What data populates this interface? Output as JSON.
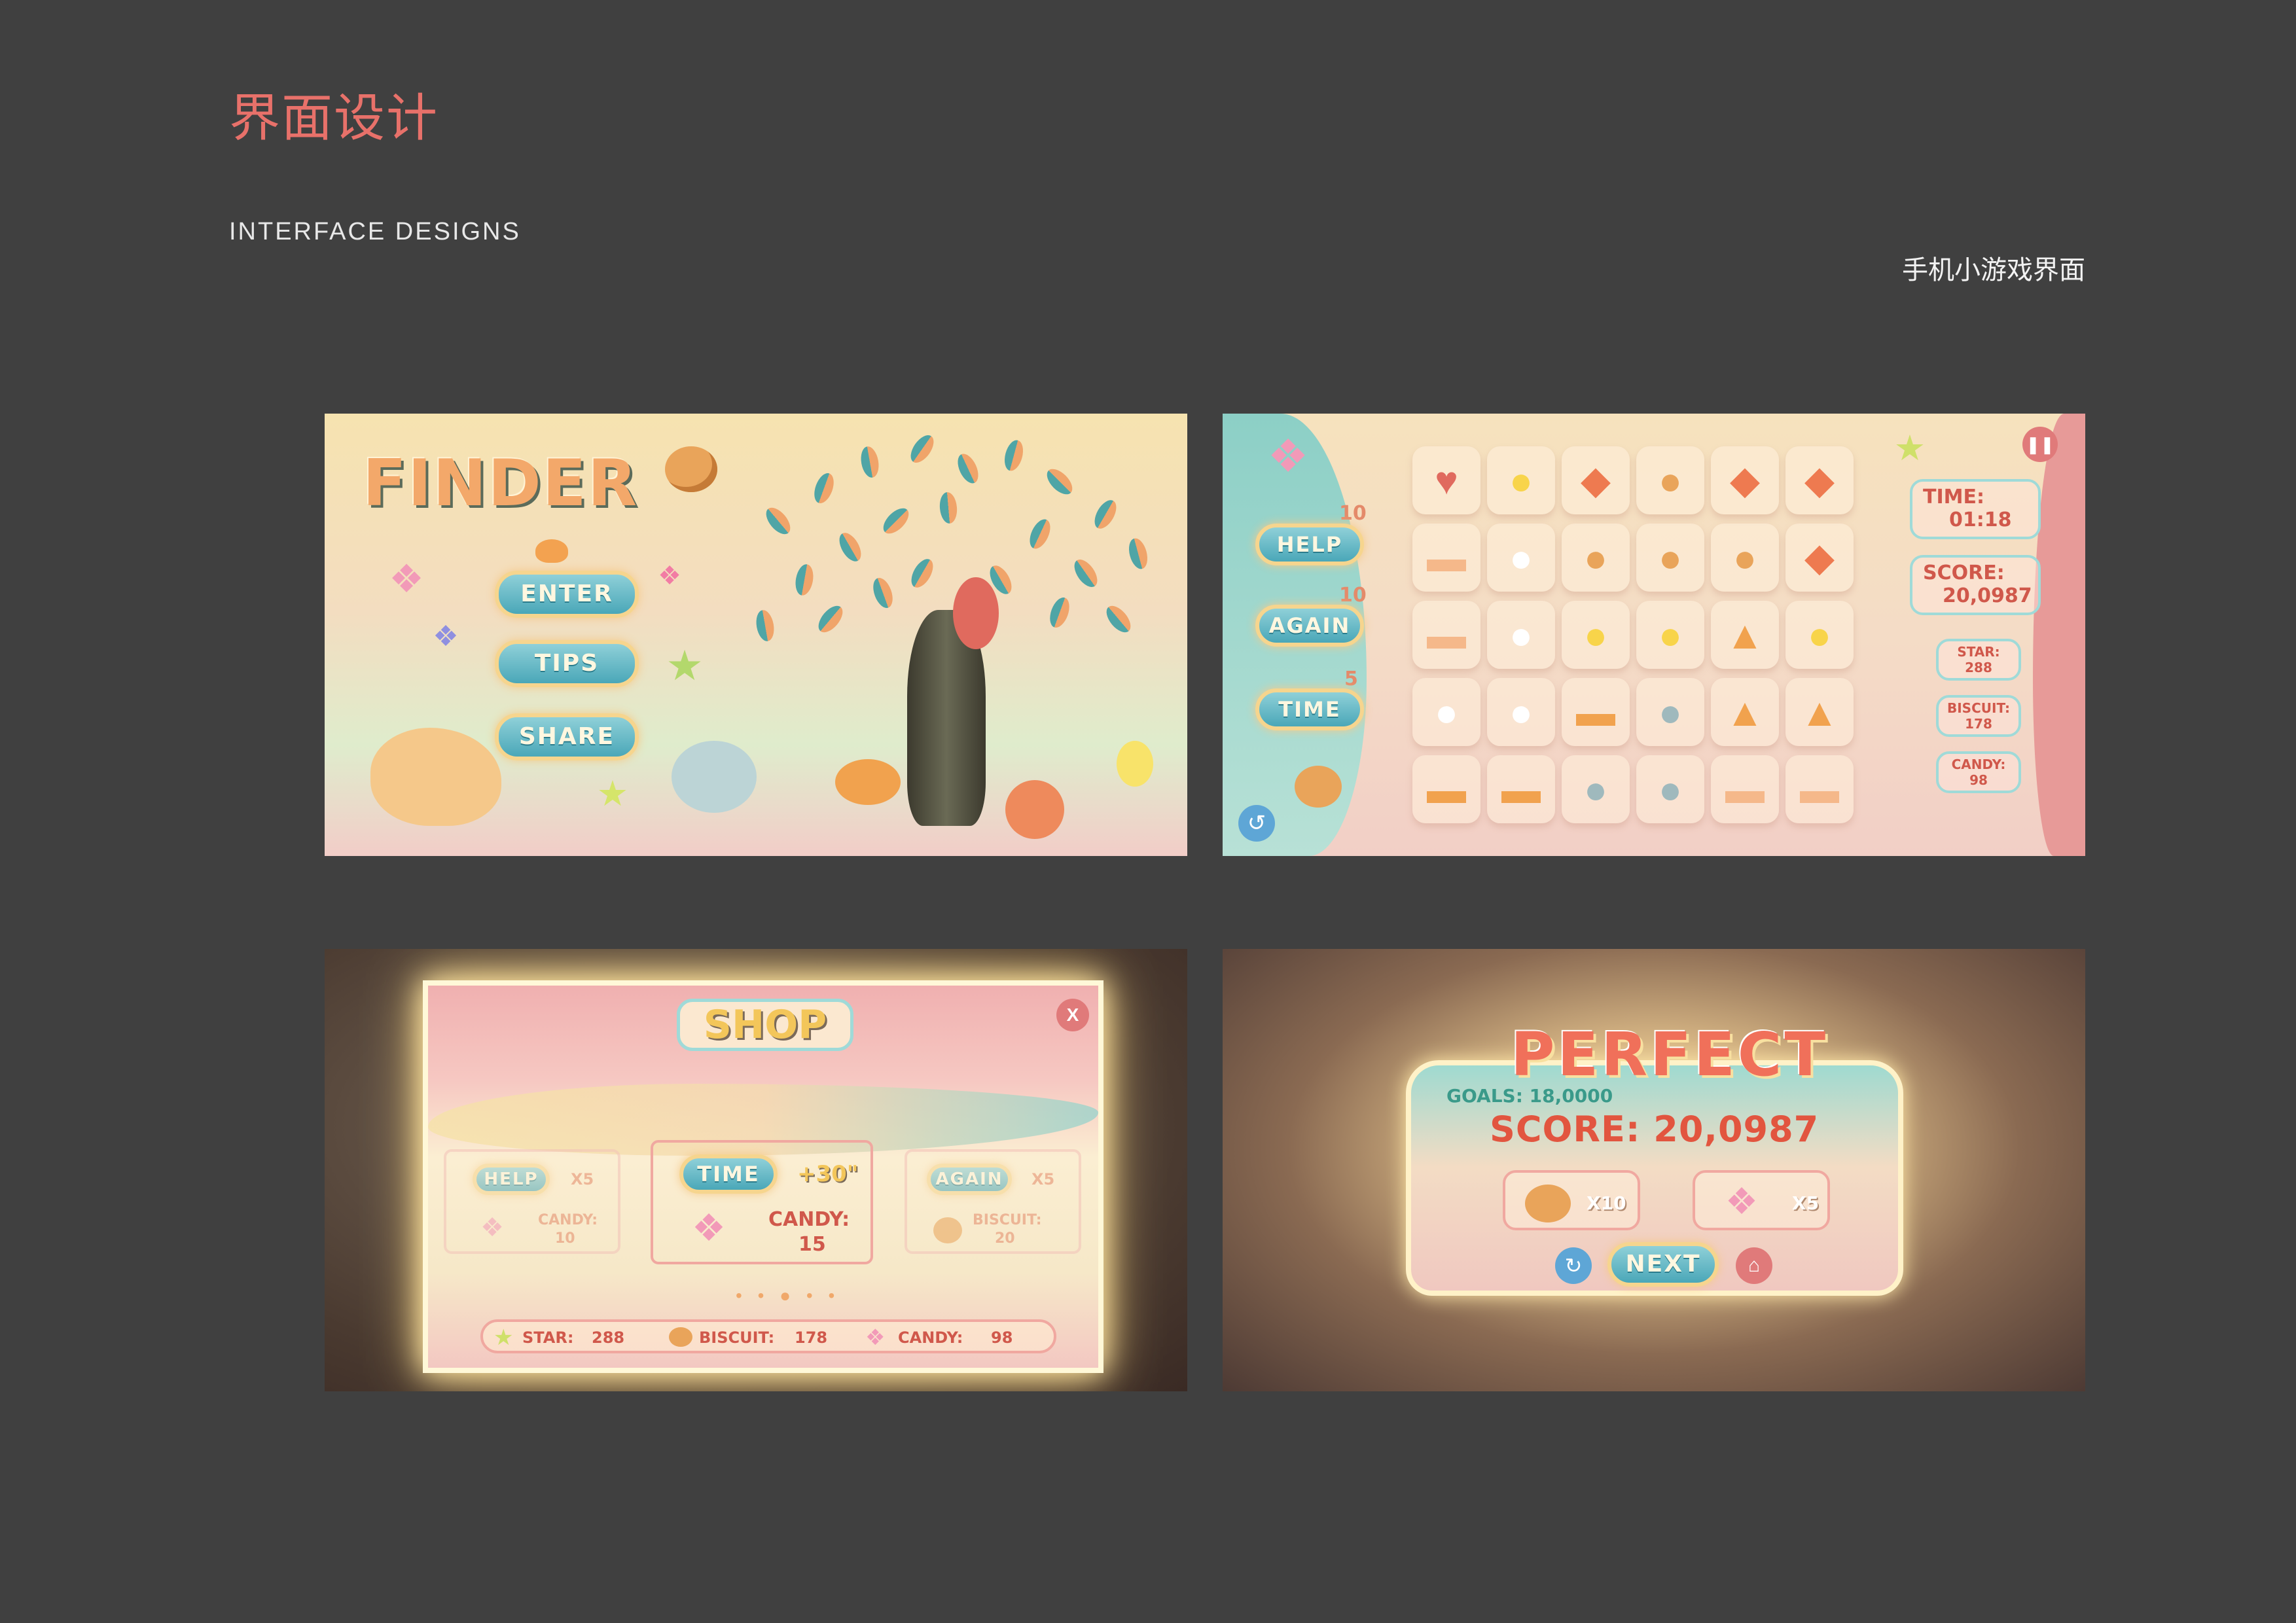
{
  "header": {
    "title_cn": "界面设计",
    "subtitle_en": "INTERFACE  DESIGNS",
    "caption_cn": "手机小游戏界面"
  },
  "start_screen": {
    "logo": "FINDER",
    "buttons": [
      "ENTER",
      "TIPS",
      "SHARE"
    ]
  },
  "game_screen": {
    "powerups": [
      {
        "label": "HELP",
        "count": "10"
      },
      {
        "label": "AGAIN",
        "count": "10"
      },
      {
        "label": "TIME",
        "count": "5"
      }
    ],
    "time_label": "TIME:",
    "time_value": "01:18",
    "score_label": "SCORE:",
    "score_value": "20,0987",
    "star_label": "STAR:",
    "star_value": "288",
    "biscuit_label": "BISCUIT:",
    "biscuit_value": "178",
    "candy_label": "CANDY:",
    "candy_value": "98"
  },
  "shop_screen": {
    "title": "SHOP",
    "close": "X",
    "items": [
      {
        "button": "HELP",
        "qty": "X5",
        "cost_label": "CANDY:",
        "cost": "10"
      },
      {
        "button": "TIME",
        "qty": "+30\"",
        "cost_label": "CANDY:",
        "cost": "15"
      },
      {
        "button": "AGAIN",
        "qty": "X5",
        "cost_label": "BISCUIT:",
        "cost": "20"
      }
    ],
    "footer": {
      "star_label": "STAR:",
      "star_value": "288",
      "biscuit_label": "BISCUIT:",
      "biscuit_value": "178",
      "candy_label": "CANDY:",
      "candy_value": "98"
    }
  },
  "result_screen": {
    "title": "PERFECT",
    "goals": "GOALS: 18,0000",
    "score": "SCORE: 20,0987",
    "reward_biscuit": "X10",
    "reward_candy": "X5",
    "next": "NEXT"
  },
  "colors": {
    "background": "#404040",
    "title_accent": "#e8716a",
    "button_teal": "#4aa7b8",
    "button_border": "#f6d58e",
    "score_red": "#d0584b"
  },
  "icons": [
    "candy-icon",
    "star-icon",
    "biscuit-icon",
    "fox-icon",
    "bird-icon",
    "chick-icon",
    "bunny-icon",
    "sheep-icon",
    "hedgehog-icon",
    "dog-icon",
    "pause-icon",
    "back-icon",
    "home-icon",
    "refresh-icon",
    "close-icon"
  ]
}
